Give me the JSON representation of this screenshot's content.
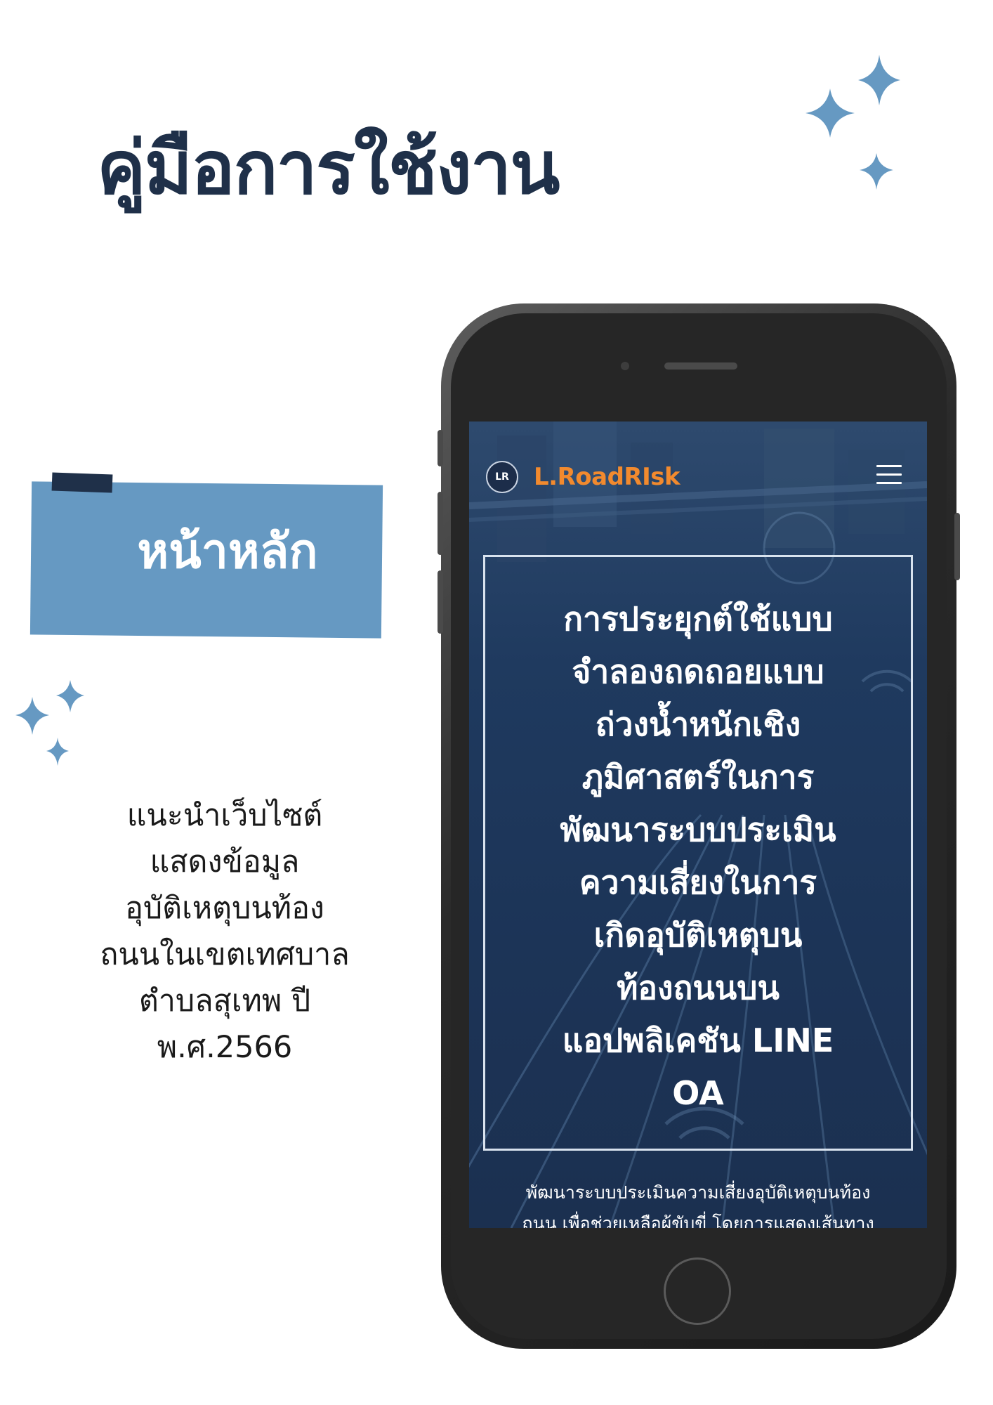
{
  "page": {
    "title": "คู่มือการใช้งาน",
    "section_label": "หน้าหลัก",
    "description": "แนะนำเว็บไซต์\nแสดงข้อมูล\nอุบัติเหตุบนท้อง\nถนนในเขตเทศบาล\nตำบลสุเทพ ปี\nพ.ศ.2566"
  },
  "site": {
    "logo_text": "LR",
    "name": "L.RoadRIsk",
    "hero_heading": "การประยุกต์ใช้แบบ\nจำลองถดถอยแบบ\nถ่วงน้ำหนักเชิง\nภูมิศาสตร์ในการ\nพัฒนาระบบประเมิน\nความเสี่ยงในการ\nเกิดอุบัติเหตุบน\nท้องถนนบน\nแอปพลิเคชัน LINE\nOA",
    "hero_subtext": "พัฒนาระบบประเมินความเสี่ยงอุบัติเหตุบนท้อง\nถนน เพื่อช่วยเหลือผู้ขับขี่ โดยการแสดงเส้นทาง"
  },
  "colors": {
    "title": "#1f3049",
    "banner": "#6699c2",
    "sparkle": "#6699c2",
    "brand_orange": "#f28a2e",
    "screen_bg": "#1f3a5f"
  },
  "icons": {
    "sparkles": "sparkle-icon",
    "menu": "hamburger-menu-icon"
  }
}
